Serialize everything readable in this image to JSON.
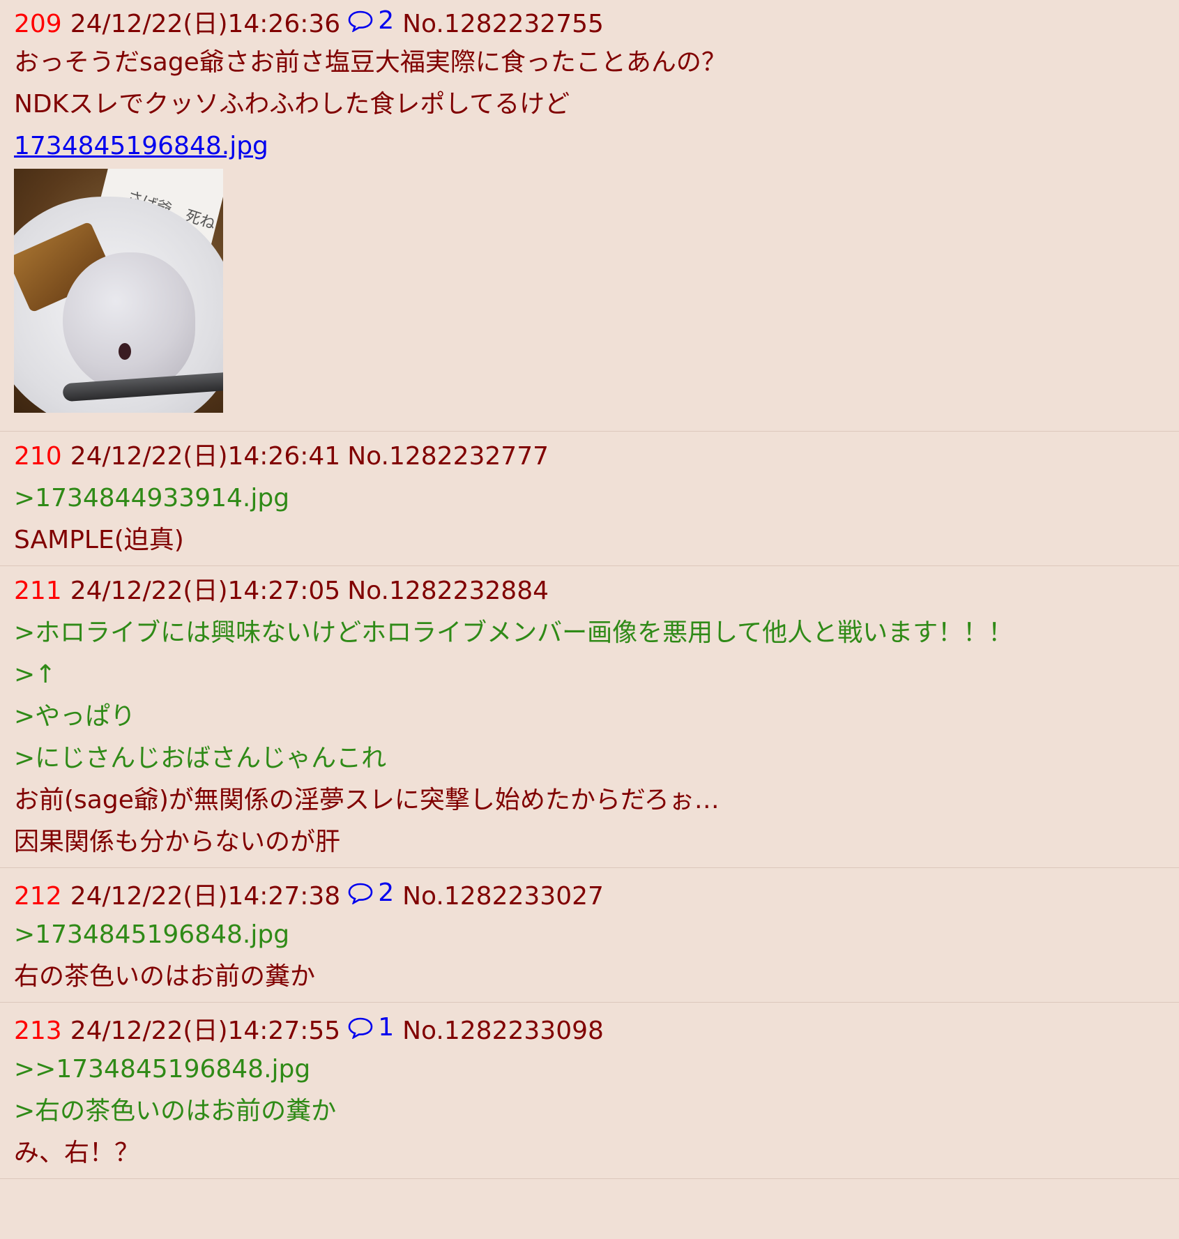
{
  "posts": [
    {
      "num": "209",
      "date": "24/12/22(日)14:26:36",
      "reply_count": "2",
      "no": "No.1282232755",
      "lines": [
        {
          "text": "おっそうだsage爺さお前さ塩豆大福実際に食ったことあんの？",
          "kind": "body"
        },
        {
          "text": "NDKスレでクッソふわふわした食レポしてるけど",
          "kind": "body"
        }
      ],
      "file": "1734845196848.jpg"
    },
    {
      "num": "210",
      "date": "24/12/22(日)14:26:41",
      "no": "No.1282232777",
      "lines": [
        {
          "text": ">1734844933914.jpg",
          "kind": "quote"
        },
        {
          "text": "SAMPLE(迫真)",
          "kind": "body"
        }
      ]
    },
    {
      "num": "211",
      "date": "24/12/22(日)14:27:05",
      "no": "No.1282232884",
      "lines": [
        {
          "text": ">ホロライブには興味ないけどホロライブメンバー画像を悪用して他人と戦います！！！",
          "kind": "quote"
        },
        {
          "text": ">↑",
          "kind": "quote"
        },
        {
          "text": ">やっぱり",
          "kind": "quote"
        },
        {
          "text": ">にじさんじおばさんじゃんこれ",
          "kind": "quote"
        },
        {
          "text": "お前(sage爺)が無関係の淫夢スレに突撃し始めたからだろぉ…",
          "kind": "body"
        },
        {
          "text": "因果関係も分からないのが肝",
          "kind": "body"
        }
      ]
    },
    {
      "num": "212",
      "date": "24/12/22(日)14:27:38",
      "reply_count": "2",
      "no": "No.1282233027",
      "lines": [
        {
          "text": ">1734845196848.jpg",
          "kind": "quote"
        },
        {
          "text": "右の茶色いのはお前の糞か",
          "kind": "body"
        }
      ]
    },
    {
      "num": "213",
      "date": "24/12/22(日)14:27:55",
      "reply_count": "1",
      "no": "No.1282233098",
      "lines": [
        {
          "text": ">>1734845196848.jpg",
          "kind": "quote"
        },
        {
          "text": ">右の茶色いのはお前の糞か",
          "kind": "quote"
        },
        {
          "text": "み、右！？",
          "kind": "body"
        }
      ]
    }
  ],
  "colors": {
    "background": "#f0e0d6",
    "post_number": "#ff0000",
    "text": "#800000",
    "quote": "#2f8a17",
    "link": "#0000ee"
  },
  "icons": {
    "reply": "speech-bubble-icon"
  },
  "thumbnail_caption": "さげ爺、死ね"
}
